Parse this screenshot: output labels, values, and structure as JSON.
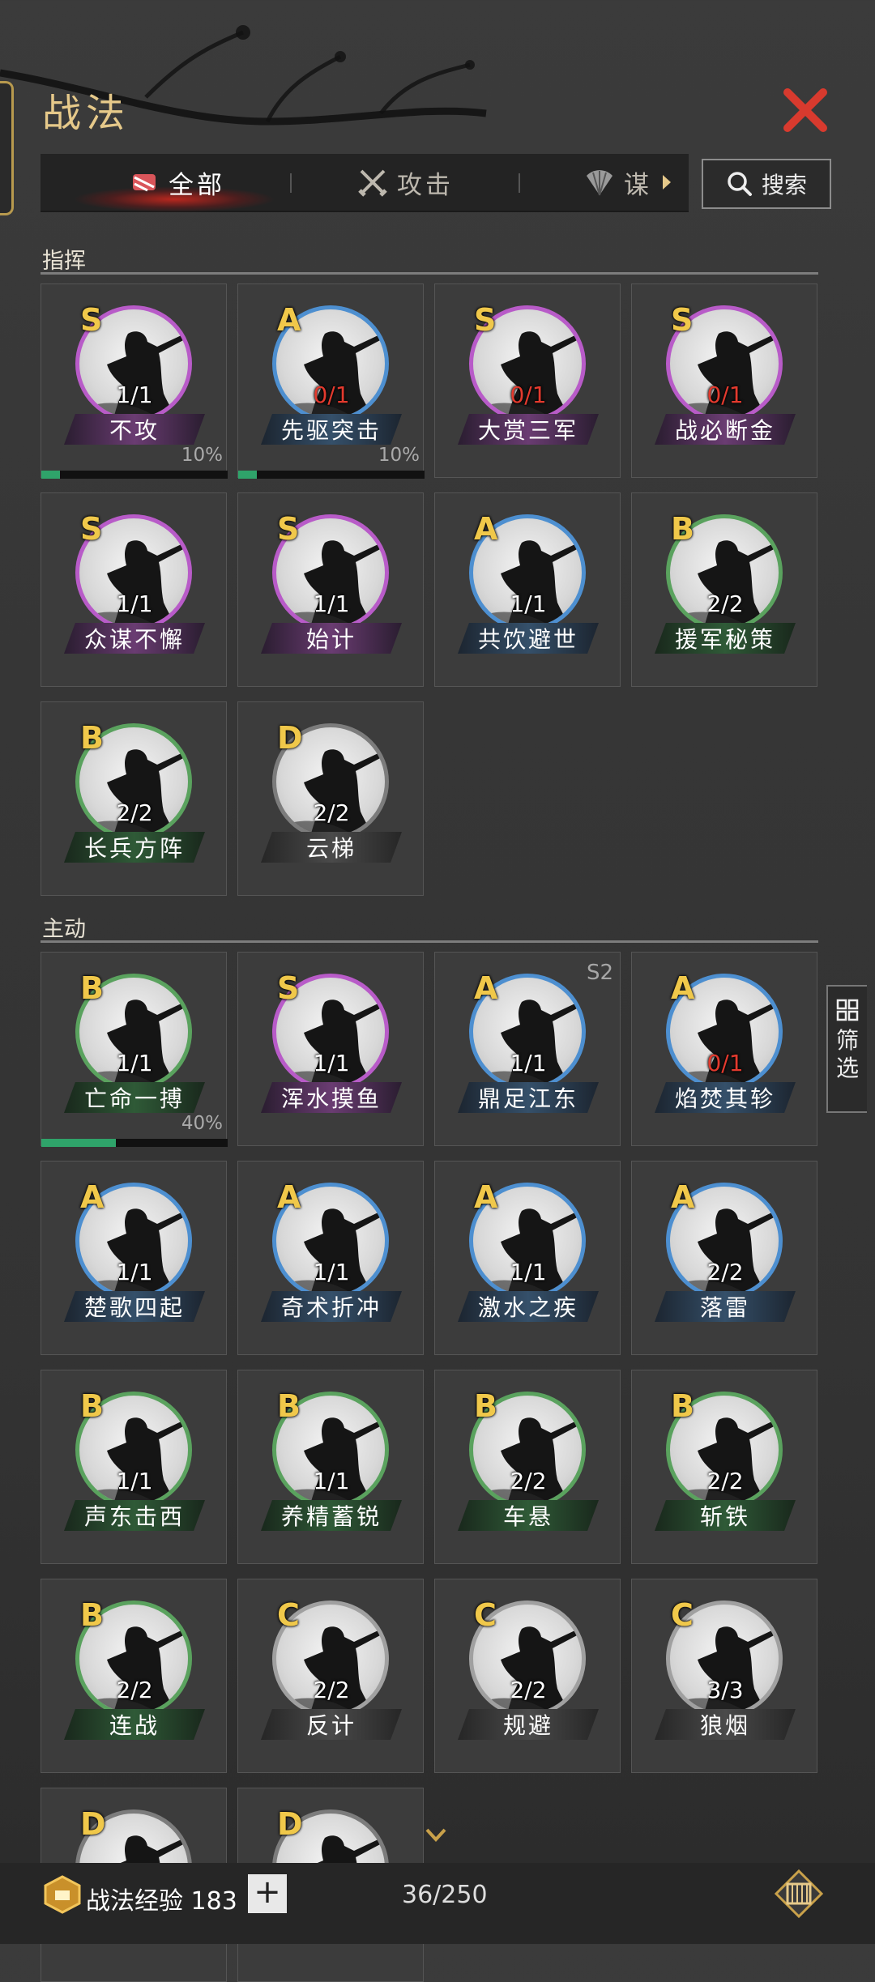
{
  "header": {
    "title": "战法"
  },
  "tabs": [
    {
      "label": "全部",
      "active": true,
      "icon": "scroll-icon"
    },
    {
      "label": "攻击",
      "active": false,
      "icon": "crossed-swords-icon"
    },
    {
      "label": "谋",
      "active": false,
      "icon": "fan-icon"
    }
  ],
  "search": {
    "label": "搜索"
  },
  "sections": {
    "command": {
      "label": "指挥"
    },
    "active": {
      "label": "主动"
    }
  },
  "command_cards": [
    {
      "grade": "S",
      "count": "1/1",
      "name": "不攻",
      "progress_percent": 10,
      "progress_label": "10%"
    },
    {
      "grade": "A",
      "count": "0/1",
      "name": "先驱突击",
      "progress_percent": 10,
      "progress_label": "10%"
    },
    {
      "grade": "S",
      "count": "0/1",
      "name": "大赏三军"
    },
    {
      "grade": "S",
      "count": "0/1",
      "name": "战必断金"
    },
    {
      "grade": "S",
      "count": "1/1",
      "name": "众谋不懈"
    },
    {
      "grade": "S",
      "count": "1/1",
      "name": "始计"
    },
    {
      "grade": "A",
      "count": "1/1",
      "name": "共饮避世"
    },
    {
      "grade": "B",
      "count": "2/2",
      "name": "援军秘策"
    },
    {
      "grade": "B",
      "count": "2/2",
      "name": "长兵方阵"
    },
    {
      "grade": "D",
      "count": "2/2",
      "name": "云梯"
    }
  ],
  "active_cards": [
    {
      "grade": "B",
      "count": "1/1",
      "name": "亡命一搏",
      "progress_percent": 40,
      "progress_label": "40%"
    },
    {
      "grade": "S",
      "count": "1/1",
      "name": "浑水摸鱼"
    },
    {
      "grade": "A",
      "count": "1/1",
      "name": "鼎足江东",
      "season": "S2"
    },
    {
      "grade": "A",
      "count": "0/1",
      "name": "焰焚其轸"
    },
    {
      "grade": "A",
      "count": "1/1",
      "name": "楚歌四起"
    },
    {
      "grade": "A",
      "count": "1/1",
      "name": "奇术折冲"
    },
    {
      "grade": "A",
      "count": "1/1",
      "name": "激水之疾"
    },
    {
      "grade": "A",
      "count": "2/2",
      "name": "落雷"
    },
    {
      "grade": "B",
      "count": "1/1",
      "name": "声东击西"
    },
    {
      "grade": "B",
      "count": "1/1",
      "name": "养精蓄锐"
    },
    {
      "grade": "B",
      "count": "2/2",
      "name": "车悬"
    },
    {
      "grade": "B",
      "count": "2/2",
      "name": "斩铁"
    },
    {
      "grade": "B",
      "count": "2/2",
      "name": "连战"
    },
    {
      "grade": "C",
      "count": "2/2",
      "name": "反计"
    },
    {
      "grade": "C",
      "count": "2/2",
      "name": "规避"
    },
    {
      "grade": "C",
      "count": "3/3",
      "name": "狼烟"
    },
    {
      "grade": "D",
      "count": "",
      "name": ""
    },
    {
      "grade": "D",
      "count": "",
      "name": ""
    }
  ],
  "filter": {
    "label": "筛选"
  },
  "footer": {
    "exp_label": "战法经验 183",
    "plus": "+",
    "capacity": "36/250"
  },
  "colors": {
    "S": "#b85bc8",
    "A": "#4d8fd0",
    "B": "#5aa25e",
    "C": "#a0a0a0",
    "D": "#7c7c7c",
    "gold": "#f0c84a",
    "close": "#d83a2e"
  }
}
